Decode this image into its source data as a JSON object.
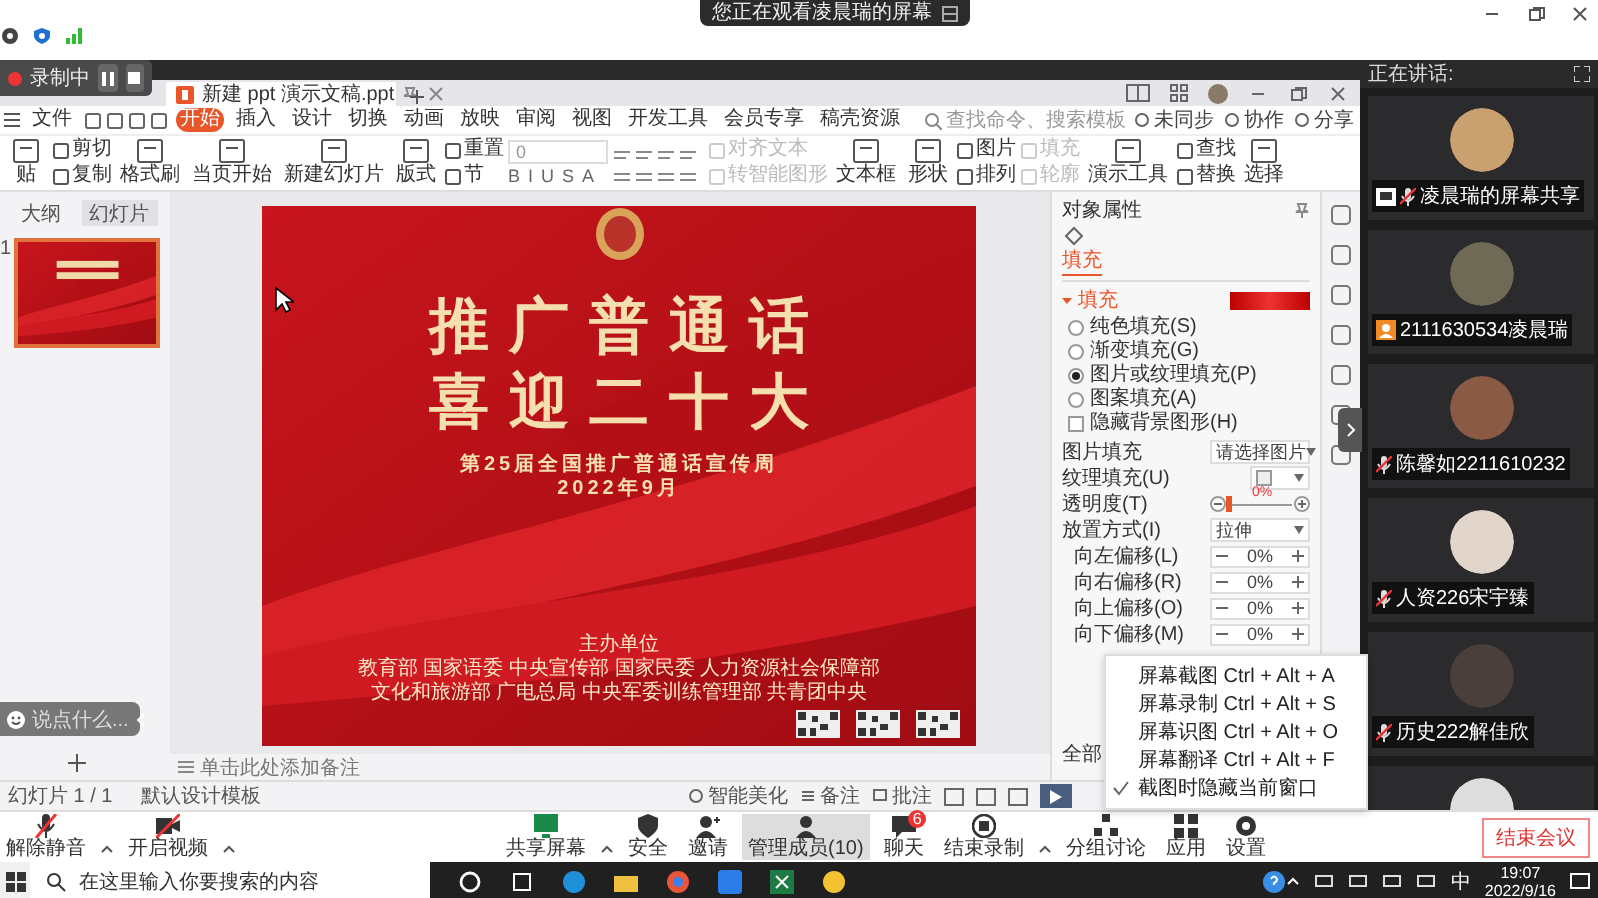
{
  "top": {
    "banner": "您正在观看凌晨瑞的屏幕"
  },
  "recording": {
    "label": "录制中"
  },
  "doc_tab": {
    "title": "新建 ppt 演示文稿.ppt"
  },
  "menu": [
    {
      "label": "文件",
      "selected": false
    },
    {
      "label": "开始",
      "selected": true
    },
    {
      "label": "插入",
      "selected": false
    },
    {
      "label": "设计",
      "selected": false
    },
    {
      "label": "切换",
      "selected": false
    },
    {
      "label": "动画",
      "selected": false
    },
    {
      "label": "放映",
      "selected": false
    },
    {
      "label": "审阅",
      "selected": false
    },
    {
      "label": "视图",
      "selected": false
    },
    {
      "label": "开发工具",
      "selected": false
    },
    {
      "label": "会员专享",
      "selected": false
    },
    {
      "label": "稿壳资源",
      "selected": false
    }
  ],
  "search": {
    "placeholder": "查找命令、搜索模板"
  },
  "header_actions": [
    {
      "label": "未同步"
    },
    {
      "label": "协作"
    },
    {
      "label": "分享"
    }
  ],
  "ribbon": [
    {
      "kind": "tools",
      "items": [
        {
          "label": "贴",
          "disabled": false
        }
      ]
    },
    {
      "kind": "tools",
      "items": [
        {
          "label": "剪切",
          "disabled": false
        },
        {
          "label": "复制",
          "disabled": false
        }
      ]
    },
    {
      "kind": "tools",
      "items": [
        {
          "label": "格式刷",
          "disabled": false
        }
      ]
    },
    {
      "kind": "tools",
      "items": [
        {
          "label": "当页开始",
          "disabled": false
        }
      ]
    },
    {
      "kind": "tools",
      "items": [
        {
          "label": "新建幻灯片",
          "disabled": false
        }
      ]
    },
    {
      "kind": "tools",
      "items": [
        {
          "label": "版式",
          "disabled": false
        }
      ]
    },
    {
      "kind": "tools",
      "items": [
        {
          "label": "重置",
          "disabled": false
        },
        {
          "label": "节",
          "disabled": false
        }
      ]
    },
    {
      "kind": "font",
      "size": "0",
      "glyphs": [
        "B",
        "I",
        "U",
        "S",
        "A"
      ]
    },
    {
      "kind": "paragraph"
    },
    {
      "kind": "tools",
      "items": [
        {
          "label": "对齐文本",
          "disabled": true
        },
        {
          "label": "转智能图形",
          "disabled": true
        }
      ]
    },
    {
      "kind": "tools",
      "items": [
        {
          "label": "文本框",
          "disabled": false
        }
      ]
    },
    {
      "kind": "tools",
      "items": [
        {
          "label": "形状",
          "disabled": false
        }
      ]
    },
    {
      "kind": "tools",
      "items": [
        {
          "label": "图片",
          "disabled": false
        },
        {
          "label": "排列",
          "disabled": false
        }
      ]
    },
    {
      "kind": "tools",
      "items": [
        {
          "label": "填充",
          "disabled": true
        },
        {
          "label": "轮廓",
          "disabled": true
        }
      ]
    },
    {
      "kind": "tools",
      "items": [
        {
          "label": "演示工具",
          "disabled": false
        }
      ]
    },
    {
      "kind": "tools",
      "items": [
        {
          "label": "查找",
          "disabled": false
        },
        {
          "label": "替换",
          "disabled": false
        }
      ]
    },
    {
      "kind": "tools",
      "items": [
        {
          "label": "选择",
          "disabled": false
        }
      ]
    }
  ],
  "panel_tabs": [
    {
      "label": "大纲",
      "selected": false
    },
    {
      "label": "幻灯片",
      "selected": true
    }
  ],
  "thumbnail_number": "1",
  "chat_placeholder": "说点什么...",
  "slide": {
    "title_lines": [
      "推广普通话",
      "喜迎二十大"
    ],
    "subtitle": "第25届全国推广普通话宣传周",
    "date": "2022年9月",
    "organizer_label": "主办单位",
    "organizers": [
      "教育部 国家语委 中央宣传部 国家民委 人力资源社会保障部",
      "文化和旅游部 广电总局 中央军委训练管理部 共青团中央"
    ]
  },
  "notes_placeholder": "单击此处添加备注",
  "status": {
    "slide_count": "幻灯片 1 / 1",
    "template": "默认设计模板",
    "beautify": "智能美化",
    "notes": "备注",
    "comments": "批注"
  },
  "properties": {
    "title": "对象属性",
    "tab": "填充",
    "section": "填充",
    "fill_options": [
      {
        "label": "纯色填充(S)",
        "selected": false
      },
      {
        "label": "渐变填充(G)",
        "selected": false
      },
      {
        "label": "图片或纹理填充(P)",
        "selected": true
      },
      {
        "label": "图案填充(A)",
        "selected": false
      }
    ],
    "hide_background": {
      "label": "隐藏背景图形(H)",
      "checked": false
    },
    "rows": [
      {
        "kind": "select",
        "label": "图片填充",
        "value": "请选择图片"
      },
      {
        "kind": "texture",
        "label": "纹理填充(U)"
      },
      {
        "kind": "slider",
        "label": "透明度(T)",
        "reading": "0%",
        "level": 0
      },
      {
        "kind": "select",
        "label": "放置方式(I)",
        "value": "拉伸"
      },
      {
        "kind": "spin",
        "label": "向左偏移(L)",
        "value": "0%"
      },
      {
        "kind": "spin",
        "label": "向右偏移(R)",
        "value": "0%"
      },
      {
        "kind": "spin",
        "label": "向上偏移(O)",
        "value": "0%"
      },
      {
        "kind": "spin",
        "label": "向下偏移(M)",
        "value": "0%"
      }
    ],
    "apply_all": "全部"
  },
  "context_menu": [
    {
      "label": "屏幕截图 Ctrl + Alt + A",
      "checked": false
    },
    {
      "label": "屏幕录制 Ctrl + Alt + S",
      "checked": false
    },
    {
      "label": "屏幕识图 Ctrl + Alt + O",
      "checked": false
    },
    {
      "label": "屏幕翻译 Ctrl + Alt + F",
      "checked": false
    },
    {
      "label": "截图时隐藏当前窗口",
      "checked": true
    }
  ],
  "speaking_label": "正在讲话:",
  "participants": [
    {
      "kind": "share",
      "name": "凌晨瑞的屏幕共享"
    },
    {
      "kind": "host",
      "name": "2111630534凌晨瑞"
    },
    {
      "kind": "muted",
      "name": "陈馨如2211610232"
    },
    {
      "kind": "muted",
      "name": "人资226宋宇臻"
    },
    {
      "kind": "muted",
      "name": "历史222解佳欣"
    },
    {
      "kind": "partial"
    }
  ],
  "meeting_left": [
    {
      "kind": "mic",
      "label": "解除静音",
      "caret": true
    },
    {
      "kind": "video",
      "label": "开启视频",
      "caret": true
    }
  ],
  "meeting_center": [
    {
      "kind": "screen",
      "label": "共享屏幕",
      "caret": true,
      "selected": false
    },
    {
      "kind": "shield",
      "label": "安全",
      "caret": false,
      "selected": false
    },
    {
      "kind": "invite",
      "label": "邀请",
      "caret": false,
      "selected": false
    },
    {
      "kind": "members",
      "label": "管理成员(10)",
      "caret": false,
      "selected": true
    },
    {
      "kind": "chat",
      "label": "聊天",
      "caret": false,
      "selected": false,
      "badge": "6"
    },
    {
      "kind": "record",
      "label": "结束录制",
      "caret": true,
      "selected": false
    },
    {
      "kind": "groups",
      "label": "分组讨论",
      "caret": false,
      "selected": false
    },
    {
      "kind": "apps",
      "label": "应用",
      "caret": false,
      "selected": false
    },
    {
      "kind": "gear",
      "label": "设置",
      "caret": false,
      "selected": false
    }
  ],
  "end_meeting": "结束会议",
  "taskbar": {
    "search_placeholder": "在这里输入你要搜索的内容",
    "ime": "中",
    "time": "19:07",
    "date": "2022/9/16"
  }
}
